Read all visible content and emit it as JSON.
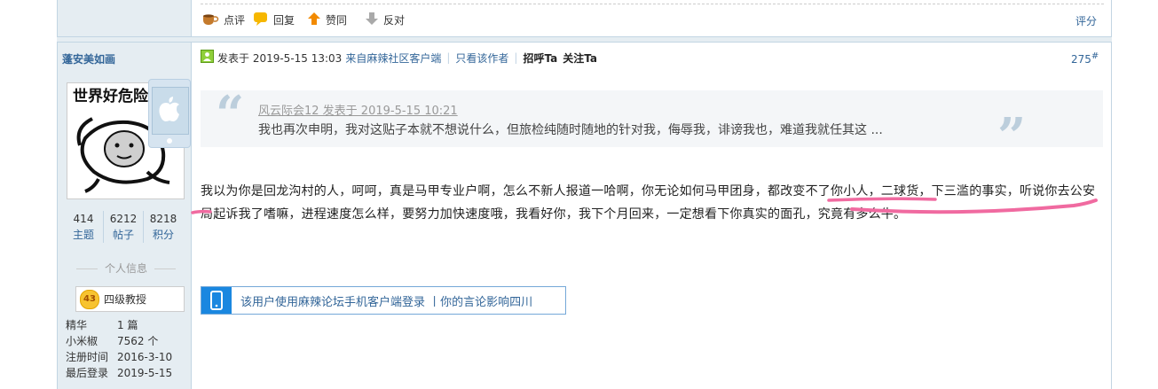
{
  "actions": {
    "comment_label": "点评",
    "reply_label": "回复",
    "upvote_label": "赞同",
    "downvote_label": "反对",
    "rate_label": "评分"
  },
  "user": {
    "name": "蓬安美如画",
    "avatar_caption": "世界好危险",
    "stats": [
      {
        "num": "414",
        "label": "主题"
      },
      {
        "num": "6212",
        "label": "帖子"
      },
      {
        "num": "8218",
        "label": "积分"
      }
    ],
    "info_title": "个人信息",
    "rank_level": "43",
    "rank_name": "四级教授",
    "info": [
      {
        "k": "精华",
        "v": "1 篇"
      },
      {
        "k": "小米椒",
        "v": "7562 个"
      },
      {
        "k": "注册时间",
        "v": "2016-3-10"
      },
      {
        "k": "最后登录",
        "v": "2019-5-15"
      }
    ]
  },
  "post_meta": {
    "posted_at": "发表于 2019-5-15 13:03",
    "source": "来自麻辣社区客户端",
    "only_author": "只看该作者",
    "greet": "招呼Ta",
    "follow": "关注Ta",
    "floor": "275",
    "floor_suffix": "#"
  },
  "quote": {
    "author_line": "风云际会12 发表于 2019-5-15 10:21",
    "text": "我也再次申明，我对这贴子本就不想说什么，但旅检纯随时随地的针对我，侮辱我，诽谤我也，难道我就任其这 ..."
  },
  "post_body": "我以为你是回龙沟村的人，呵呵，真是马甲专业户啊，怎么不新人报道一哈啊，你无论如何马甲团身，都改变不了你小人，二球货，下三滥的事实，听说你去公安局起诉我了嗜嘛，进程速度怎么样，要努力加快速度哦，我看好你，我下个月回来，一定想看下你真实的面孔，究竟有多么牛。",
  "mobile_bar": {
    "text": "该用户使用麻辣论坛手机客户端登录 丨你的言论影响四川"
  },
  "colors": {
    "link": "#336699",
    "sidebar_bg": "#e5edf2",
    "annotation": "#f06aa0"
  }
}
